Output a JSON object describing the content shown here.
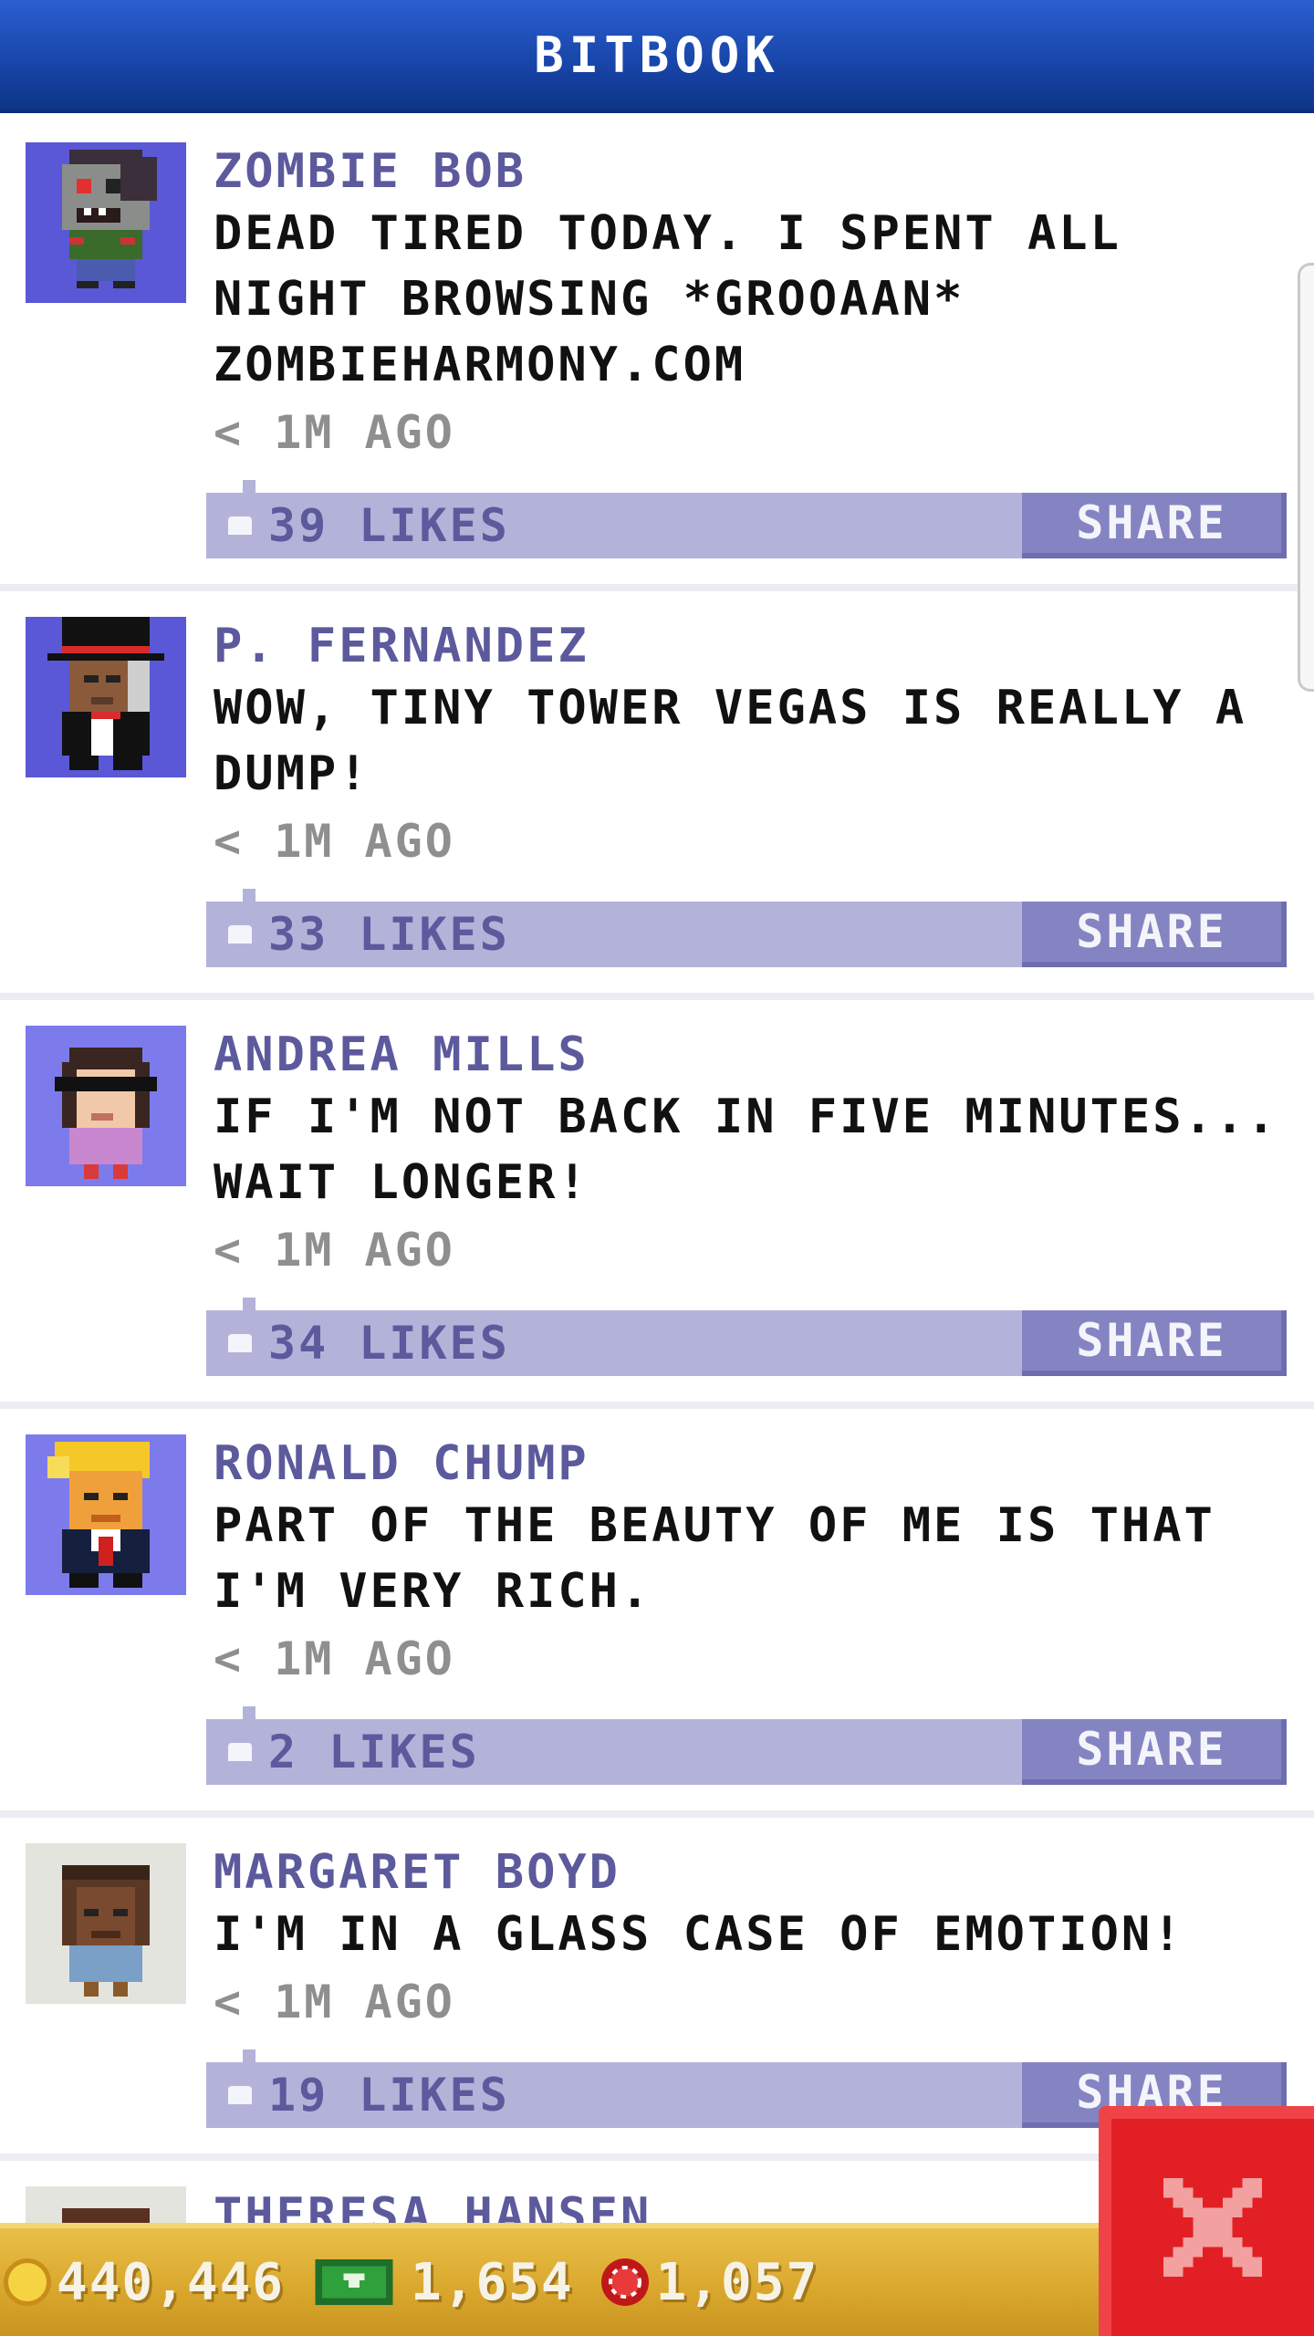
{
  "header": {
    "title": "BITBOOK"
  },
  "posts": [
    {
      "author": "ZOMBIE BOB",
      "message": "DEAD TIRED TODAY. I SPENT ALL NIGHT BROWSING *GROOAAN* ZOMBIEHARMONY.COM",
      "time": "< 1M AGO",
      "likes": "39 LIKES",
      "share": "SHARE",
      "avatar_icon": "zombie-avatar-icon"
    },
    {
      "author": "P. FERNANDEZ",
      "message": "WOW, TINY TOWER VEGAS IS REALLY A DUMP!",
      "time": "< 1M AGO",
      "likes": "33 LIKES",
      "share": "SHARE",
      "avatar_icon": "top-hat-avatar-icon"
    },
    {
      "author": "ANDREA MILLS",
      "message": "IF I'M NOT BACK IN FIVE MINUTES... WAIT LONGER!",
      "time": "< 1M AGO",
      "likes": "34 LIKES",
      "share": "SHARE",
      "avatar_icon": "sunglasses-avatar-icon"
    },
    {
      "author": "RONALD CHUMP",
      "message": "PART OF THE BEAUTY OF ME IS THAT I'M VERY RICH.",
      "time": "< 1M AGO",
      "likes": "2 LIKES",
      "share": "SHARE",
      "avatar_icon": "blond-suit-avatar-icon"
    },
    {
      "author": "MARGARET BOYD",
      "message": "I'M IN A GLASS CASE OF EMOTION!",
      "time": "< 1M AGO",
      "likes": "19 LIKES",
      "share": "SHARE",
      "avatar_icon": "dark-hair-avatar-icon"
    },
    {
      "author": "THERESA HANSEN",
      "message": "",
      "time": "",
      "likes": "",
      "share": "",
      "avatar_icon": "brown-hair-avatar-icon"
    }
  ],
  "footer": {
    "coins": "440,446",
    "bux": "1,654",
    "chips": "1,057"
  },
  "colors": {
    "header_blue": "#1440a0",
    "accent_purple": "#5c5a9c",
    "bar_lavender": "#b3b3da",
    "footer_gold": "#d9a62c",
    "close_red": "#e21f24"
  }
}
